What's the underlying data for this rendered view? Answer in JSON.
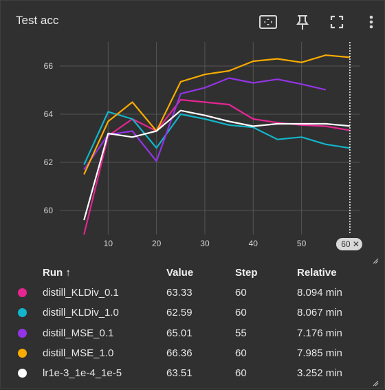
{
  "card": {
    "title": "Test acc"
  },
  "toolbar": {
    "icons": [
      "fit-domain-icon",
      "pin-icon",
      "fullscreen-icon",
      "more-vert-icon"
    ]
  },
  "chart_data": {
    "type": "line",
    "xlim": [
      0,
      62
    ],
    "ylim": [
      59,
      67
    ],
    "xticks": [
      10,
      20,
      30,
      40,
      50
    ],
    "yticks": [
      60,
      62,
      64,
      66
    ],
    "x_tick_labels": [
      "10",
      "20",
      "30",
      "40",
      "50"
    ],
    "y_tick_labels": [
      "60",
      "62",
      "64",
      "66"
    ],
    "grid": true,
    "hover_step_label": "60",
    "series": [
      {
        "name": "distill_KLDiv_0.1",
        "color": "#e52592",
        "x": [
          5,
          10,
          15,
          20,
          25,
          30,
          35,
          40,
          45,
          50,
          55,
          60
        ],
        "y": [
          59.0,
          63.1,
          63.8,
          63.3,
          64.6,
          64.5,
          64.4,
          63.8,
          63.65,
          63.55,
          63.5,
          63.33
        ]
      },
      {
        "name": "distill_KLDiv_1.0",
        "color": "#12b5cb",
        "x": [
          5,
          10,
          15,
          20,
          25,
          30,
          35,
          40,
          45,
          50,
          55,
          60
        ],
        "y": [
          61.9,
          64.1,
          63.8,
          62.6,
          64.0,
          63.8,
          63.55,
          63.45,
          62.95,
          63.05,
          62.75,
          62.59
        ]
      },
      {
        "name": "distill_MSE_0.1",
        "color": "#9334e6",
        "x": [
          5,
          10,
          15,
          20,
          25,
          30,
          35,
          40,
          45,
          50,
          55
        ],
        "y": [
          61.7,
          63.15,
          63.3,
          62.05,
          64.85,
          65.1,
          65.5,
          65.3,
          65.45,
          65.25,
          65.01
        ]
      },
      {
        "name": "distill_MSE_1.0",
        "color": "#f9ab00",
        "x": [
          5,
          10,
          15,
          20,
          25,
          30,
          35,
          40,
          45,
          50,
          55,
          60
        ],
        "y": [
          61.5,
          63.7,
          64.5,
          63.3,
          65.35,
          65.65,
          65.8,
          66.2,
          66.3,
          66.15,
          66.45,
          66.36
        ]
      },
      {
        "name": "lr1e-3_1e-4_1e-5",
        "color": "#ffffff",
        "x": [
          5,
          10,
          15,
          20,
          25,
          30,
          35,
          40,
          45,
          50,
          55,
          60
        ],
        "y": [
          59.6,
          63.2,
          63.05,
          63.3,
          64.15,
          63.95,
          63.7,
          63.5,
          63.6,
          63.6,
          63.6,
          63.51
        ]
      }
    ]
  },
  "table": {
    "headers": {
      "run": "Run ↑",
      "value": "Value",
      "step": "Step",
      "relative": "Relative"
    },
    "rows": [
      {
        "run": "distill_KLDiv_0.1",
        "value": "63.33",
        "step": "60",
        "relative": "8.094 min",
        "color": "#e52592"
      },
      {
        "run": "distill_KLDiv_1.0",
        "value": "62.59",
        "step": "60",
        "relative": "8.067 min",
        "color": "#12b5cb"
      },
      {
        "run": "distill_MSE_0.1",
        "value": "65.01",
        "step": "55",
        "relative": "7.176 min",
        "color": "#9334e6"
      },
      {
        "run": "distill_MSE_1.0",
        "value": "66.36",
        "step": "60",
        "relative": "7.985 min",
        "color": "#f9ab00"
      },
      {
        "run": "lr1e-3_1e-4_1e-5",
        "value": "63.51",
        "step": "60",
        "relative": "3.252 min",
        "color": "#ffffff"
      }
    ]
  }
}
